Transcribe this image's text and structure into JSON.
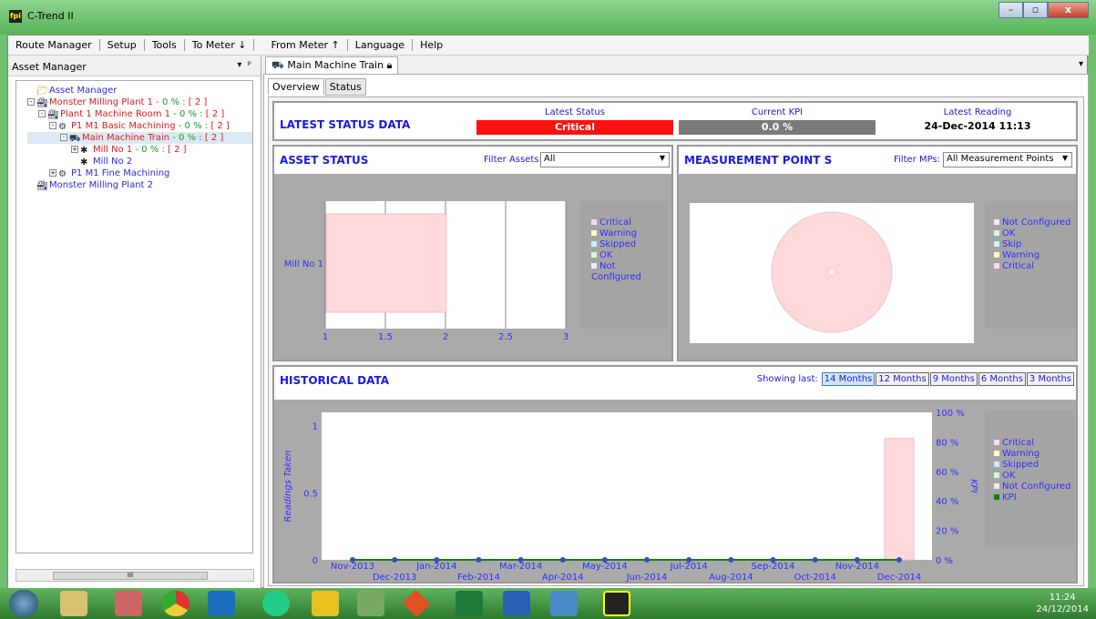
{
  "window": {
    "title": "C-Trend II",
    "app_icon_text": "fpi"
  },
  "menubar": {
    "items": [
      "Route Manager",
      "Setup",
      "Tools",
      "To Meter ↓",
      "From Meter ↑",
      "Language",
      "Help"
    ]
  },
  "left_pane": {
    "header": "Asset Manager",
    "tree": [
      {
        "label": "Asset Manager",
        "pct": "",
        "count": "",
        "color": "blu",
        "depth": 0,
        "icon": "folder-icon",
        "exp": ""
      },
      {
        "label": "Monster Milling Plant 1",
        "pct": " - 0 % : ",
        "count": "[ 2 ]",
        "color": "red",
        "depth": 0,
        "icon": "plant-icon",
        "exp": "-"
      },
      {
        "label": "Plant 1 Machine Room 1",
        "pct": " - 0 % : ",
        "count": "[ 2 ]",
        "color": "red",
        "depth": 1,
        "icon": "plant-icon",
        "exp": "-"
      },
      {
        "label": "P1 M1 Basic Machining ",
        "pct": " - 0 % : ",
        "count": "[ 2 ]",
        "color": "red",
        "depth": 2,
        "icon": "machine-icon",
        "exp": "-"
      },
      {
        "label": "Main Machine Train",
        "pct": " - 0 % : ",
        "count": "[ 2 ]",
        "color": "red",
        "depth": 3,
        "icon": "train-icon",
        "exp": "-"
      },
      {
        "label": "Mill No 1",
        "pct": " - 0 % : ",
        "count": "[ 2 ]",
        "color": "red",
        "depth": 4,
        "icon": "fan-icon",
        "exp": "+"
      },
      {
        "label": "Mill No 2",
        "pct": "",
        "count": "",
        "color": "blu",
        "depth": 4,
        "icon": "fan-icon",
        "exp": ""
      },
      {
        "label": "P1 M1 Fine Machining",
        "pct": "",
        "count": "",
        "color": "blu",
        "depth": 2,
        "icon": "machine-icon",
        "exp": "+"
      },
      {
        "label": "Monster Milling Plant 2",
        "pct": "",
        "count": "",
        "color": "blu",
        "depth": 0,
        "icon": "plant-icon",
        "exp": ""
      }
    ],
    "scroll_mark": "III"
  },
  "doc_tab": {
    "label": "Main Machine Train"
  },
  "sub_tabs": [
    "Overview",
    "Status"
  ],
  "latest_status": {
    "heading": "LATEST STATUS DATA",
    "status_label": "Latest Status",
    "status_value": "Critical",
    "status_color": "#ff1010",
    "kpi_label": "Current KPI",
    "kpi_value": "0.0 %",
    "kpi_color": "#7a7a7a",
    "reading_label": "Latest Reading",
    "reading_value": "24-Dec-2014 11:13"
  },
  "asset_status": {
    "heading": "ASSET STATUS",
    "filter_label": "Filter Assets:",
    "filter_value": "All",
    "legend": [
      "Critical",
      "Warning",
      "Skipped",
      "OK",
      "Not Configured"
    ],
    "legend_colors": [
      "#ffd8f0",
      "#ffffc0",
      "#c8f0ff",
      "#d0ffd0",
      "#f0e8ff"
    ]
  },
  "measurement_points": {
    "heading": "MEASUREMENT POINT S",
    "filter_label": "Filter MPs:",
    "filter_value": "All Measurement Points",
    "legend": [
      "Not Configured",
      "OK",
      "Skip",
      "Warning",
      "Critical"
    ],
    "legend_colors": [
      "#f0e8ff",
      "#d0ffd0",
      "#c8f0ff",
      "#ffffc0",
      "#ffd8f0"
    ]
  },
  "historical": {
    "heading": "HISTORICAL DATA",
    "showing_label": "Showing last:",
    "ranges": [
      "14 Months",
      "12 Months",
      "9 Months",
      "6 Months",
      "3 Months"
    ],
    "active_range": "14 Months",
    "legend": [
      "Critical",
      "Warning",
      "Skipped",
      "OK",
      "Not Configured",
      "KPI"
    ],
    "legend_colors": [
      "#ffd8f0",
      "#ffffc0",
      "#c8f0ff",
      "#d0ffd0",
      "#f0e8ff",
      "#1a7a1a"
    ]
  },
  "chart_data": [
    {
      "type": "bar",
      "orientation": "horizontal",
      "categories": [
        "Mill No 1"
      ],
      "series": [
        {
          "name": "Critical",
          "values": [
            2
          ]
        }
      ],
      "xlim": [
        1,
        3
      ],
      "xticks": [
        "1",
        "1.5",
        "2",
        "2.5",
        "3"
      ]
    },
    {
      "type": "pie",
      "labels": [
        "Critical"
      ],
      "values": [
        100
      ]
    },
    {
      "type": "bar",
      "categories": [
        "Nov-2013",
        "Dec-2013",
        "Jan-2014",
        "Feb-2014",
        "Mar-2014",
        "Apr-2014",
        "May-2014",
        "Jun-2014",
        "Jul-2014",
        "Aug-2014",
        "Sep-2014",
        "Oct-2014",
        "Nov-2014",
        "Dec-2014"
      ],
      "series": [
        {
          "name": "Critical",
          "values": [
            0,
            0,
            0,
            0,
            0,
            0,
            0,
            0,
            0,
            0,
            0,
            0,
            0,
            1
          ]
        },
        {
          "name": "KPI",
          "values": [
            0,
            0,
            0,
            0,
            0,
            0,
            0,
            0,
            0,
            0,
            0,
            0,
            0,
            0
          ]
        }
      ],
      "ylabel": "Readings Taken",
      "y2label": "KPI",
      "yticks": [
        "0",
        "0.5",
        "1"
      ],
      "y2ticks": [
        "0 %",
        "20 %",
        "40 %",
        "60 %",
        "80 %",
        "100 %"
      ],
      "ylim": [
        0,
        1.1
      ],
      "y2lim": [
        0,
        100
      ]
    }
  ],
  "taskbar": {
    "time": "11:24",
    "date": "24/12/2014"
  }
}
